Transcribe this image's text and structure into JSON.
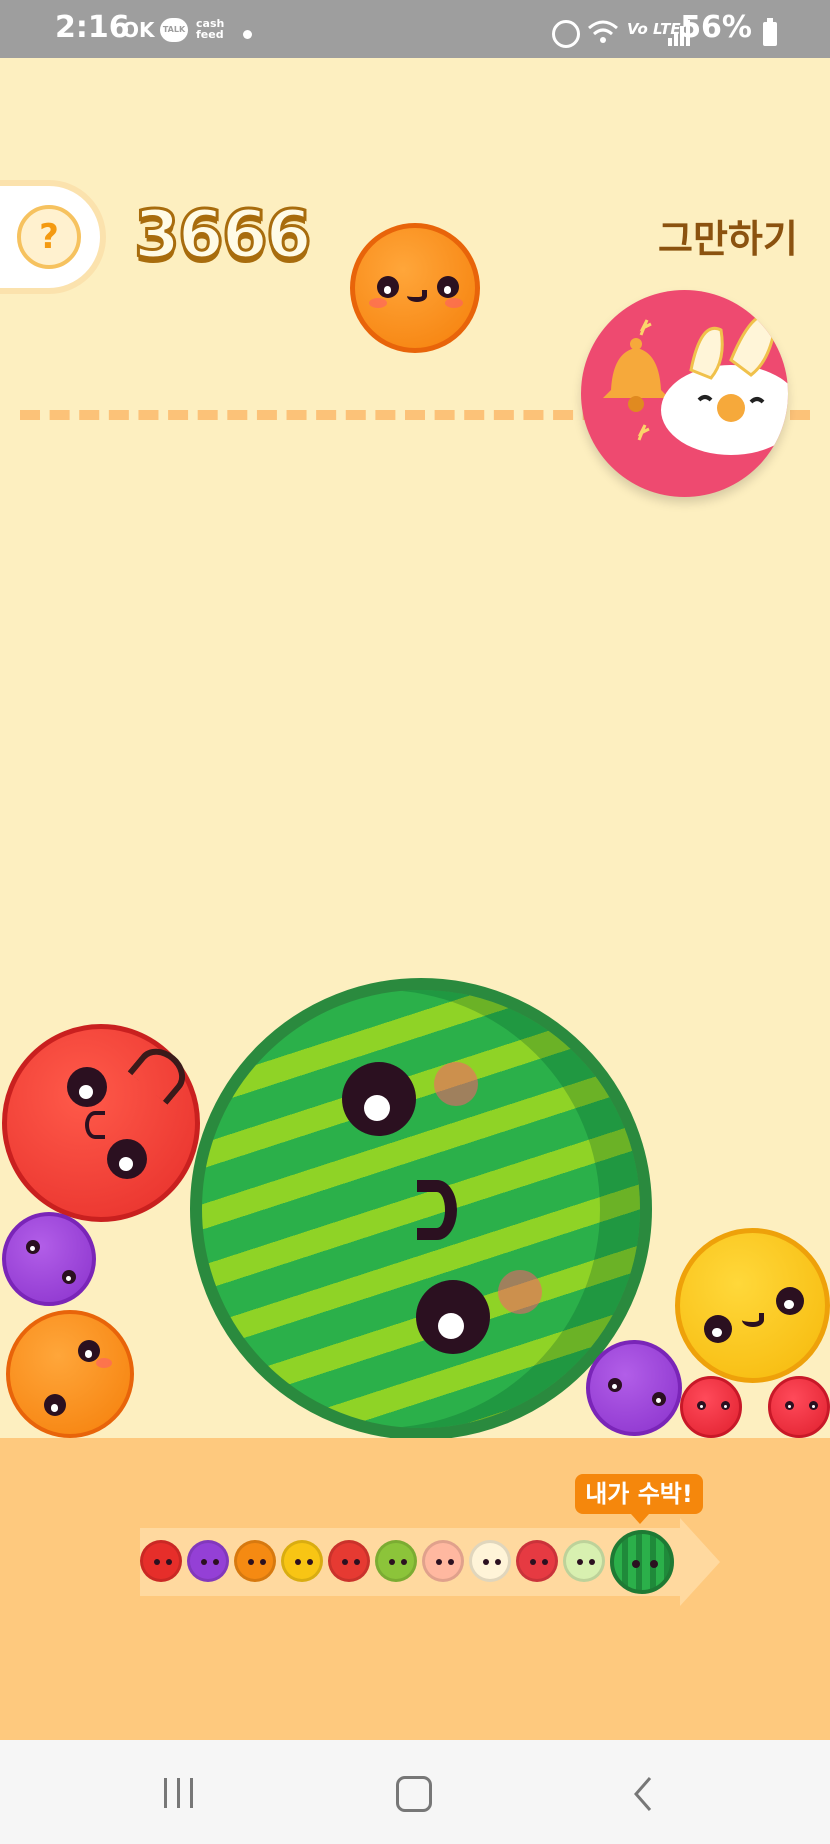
{
  "status_bar": {
    "time": "2:16",
    "left_icons": [
      "OK",
      "TALK",
      "cash feed"
    ],
    "battery_pct": "56%",
    "right_icons": [
      "alarm-icon",
      "wifi-icon",
      "volte-icon",
      "signal-icon",
      "battery-icon"
    ]
  },
  "game": {
    "help_label": "?",
    "score": "3666",
    "quit_label": "그만하기",
    "current_fruit": "orange",
    "ad_bubble_icon": "bell-cat-icon"
  },
  "evolution": {
    "badge_label": "내가 수박!",
    "fruits": [
      "cherry",
      "grape",
      "orange",
      "lemon",
      "apple",
      "kiwi",
      "peach",
      "pear",
      "tomato",
      "melon",
      "watermelon"
    ]
  },
  "colors": {
    "background": "#fdefc0",
    "bottom_panel": "#fec97e",
    "score_outline": "#a86c0d",
    "quit_text": "#8b520f",
    "badge": "#f5870c"
  },
  "nav_bar": {
    "recents_icon": "recents-icon",
    "home_icon": "home-icon",
    "back_icon": "back-icon"
  }
}
